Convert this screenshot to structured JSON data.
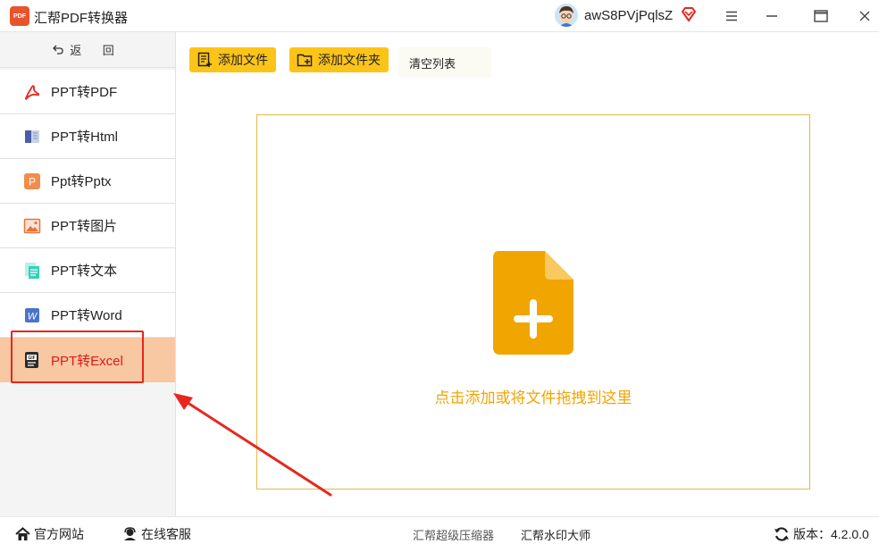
{
  "titlebar": {
    "logo_text": "PDF",
    "title": "汇帮PDF转换器",
    "username": "awS8PVjPqlsZ",
    "icons": [
      "avatar",
      "vip-diamond-icon",
      "menu-icon",
      "maximize-icon",
      "close-icon"
    ]
  },
  "sidebar": {
    "back_label": "返 回",
    "items": [
      {
        "label": "PPT转PDF",
        "icon": "pdf-icon"
      },
      {
        "label": "PPT转Html",
        "icon": "html-icon"
      },
      {
        "label": "Ppt转Pptx",
        "icon": "pptx-icon"
      },
      {
        "label": "PPT转图片",
        "icon": "image-icon"
      },
      {
        "label": "PPT转文本",
        "icon": "text-icon"
      },
      {
        "label": "PPT转Word",
        "icon": "word-icon"
      },
      {
        "label": "PPT转Excel",
        "icon": "excel-icon",
        "active": true
      }
    ]
  },
  "toolbar": {
    "add_file": "添加文件",
    "add_folder": "添加文件夹",
    "clear_list": "清空列表"
  },
  "dropzone": {
    "hint": "点击添加或将文件拖拽到这里"
  },
  "statusbar": {
    "website": "官方网站",
    "service": "在线客服",
    "compressor": "汇帮超级压缩器",
    "watermark": "汇帮水印大师",
    "version_label": "版本：",
    "version": "4.2.0.0"
  },
  "colors": {
    "accent": "#fcc419",
    "active_bg": "#f7c8a2",
    "active_text": "#e01818",
    "drop_border": "#e6b84a",
    "drop_text": "#f0a500",
    "annotation": "#e8261e"
  }
}
